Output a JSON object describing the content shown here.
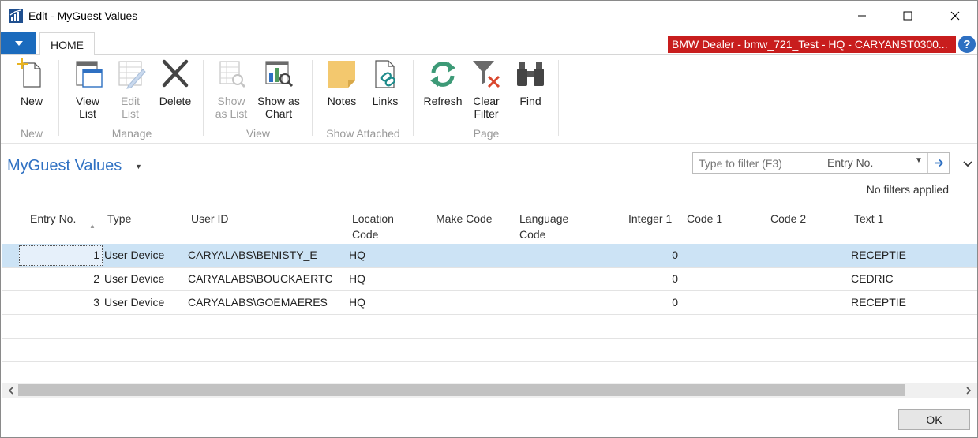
{
  "window": {
    "title": "Edit - MyGuest Values",
    "controls": {
      "minimize": "minimize-icon",
      "maximize": "maximize-icon",
      "close": "close-icon"
    }
  },
  "ribbon": {
    "tab_home": "HOME",
    "company": "BMW Dealer - bmw_721_Test - HQ - CARYANST0300...",
    "help": "?",
    "buttons": {
      "new": "New",
      "view_list_1": "View",
      "view_list_2": "List",
      "edit_list_1": "Edit",
      "edit_list_2": "List",
      "delete": "Delete",
      "show_as_list_1": "Show",
      "show_as_list_2": "as List",
      "show_as_chart_1": "Show as",
      "show_as_chart_2": "Chart",
      "notes": "Notes",
      "links": "Links",
      "refresh": "Refresh",
      "clear_filter_1": "Clear",
      "clear_filter_2": "Filter",
      "find": "Find"
    },
    "groups": {
      "new": "New",
      "manage": "Manage",
      "view": "View",
      "show_attached": "Show Attached",
      "page": "Page"
    }
  },
  "page": {
    "title": "MyGuest Values",
    "filter_placeholder": "Type to filter (F3)",
    "filter_field": "Entry No.",
    "filter_status": "No filters applied"
  },
  "grid": {
    "columns": {
      "entry_no": "Entry No.",
      "type": "Type",
      "user_id": "User ID",
      "location_code_1": "Location",
      "location_code_2": "Code",
      "make_code": "Make Code",
      "language_code_1": "Language",
      "language_code_2": "Code",
      "integer_1": "Integer 1",
      "code_1": "Code 1",
      "code_2": "Code 2",
      "text_1": "Text 1"
    },
    "rows": [
      {
        "entry_no": "1",
        "type": "User Device",
        "user_id": "CARYALABS\\BENISTY_E",
        "location_code": "HQ",
        "make_code": "",
        "language_code": "",
        "integer_1": "0",
        "code_1": "",
        "code_2": "",
        "text_1": "RECEPTIE"
      },
      {
        "entry_no": "2",
        "type": "User Device",
        "user_id": "CARYALABS\\BOUCKAERTC",
        "location_code": "HQ",
        "make_code": "",
        "language_code": "",
        "integer_1": "0",
        "code_1": "",
        "code_2": "",
        "text_1": "CEDRIC"
      },
      {
        "entry_no": "3",
        "type": "User Device",
        "user_id": "CARYALABS\\GOEMAERES",
        "location_code": "HQ",
        "make_code": "",
        "language_code": "",
        "integer_1": "0",
        "code_1": "",
        "code_2": "",
        "text_1": "RECEPTIE"
      }
    ]
  },
  "footer": {
    "ok_label": "OK"
  },
  "colors": {
    "accent": "#2e70c2",
    "company_badge": "#c81d1d",
    "selected_row": "#cce3f5"
  }
}
